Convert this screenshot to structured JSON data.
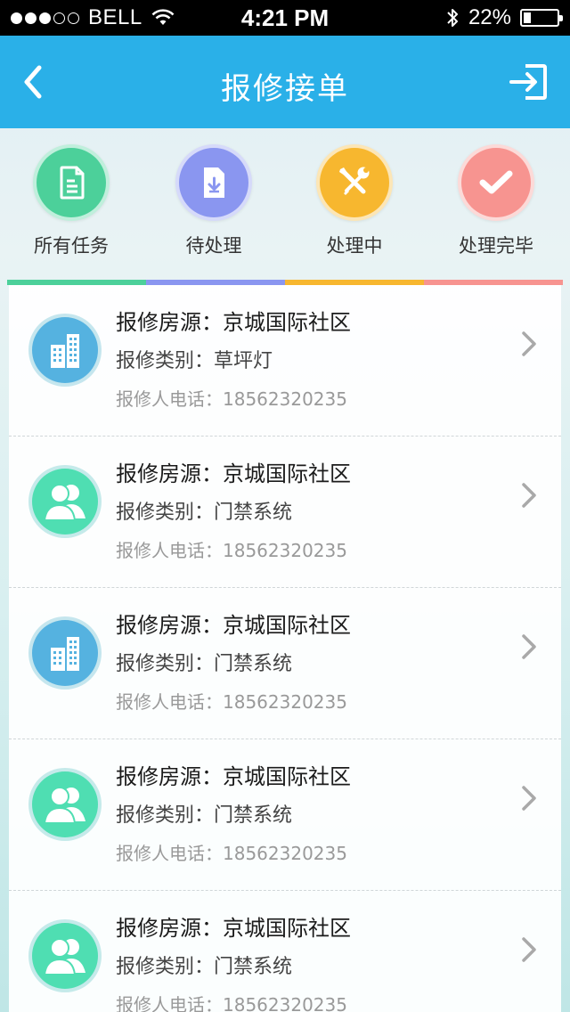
{
  "status_bar": {
    "carrier": "BELL",
    "time": "4:21 PM",
    "battery_percent": "22%",
    "battery_level": 0.22,
    "signal_bars_filled": 3,
    "signal_bars_total": 5
  },
  "nav": {
    "title": "报修接单",
    "back_icon": "chevron-left-icon",
    "logout_icon": "logout-icon"
  },
  "categories": [
    {
      "label": "所有任务",
      "color": "#4cd09a",
      "icon": "document-icon"
    },
    {
      "label": "待处理",
      "color": "#8a96f0",
      "icon": "download-document-icon"
    },
    {
      "label": "处理中",
      "color": "#f7b72f",
      "icon": "tools-icon"
    },
    {
      "label": "处理完毕",
      "color": "#f79490",
      "icon": "checkmark-icon"
    }
  ],
  "tab_colors": [
    "#4cd09a",
    "#8a96f0",
    "#f7b72f",
    "#f79490"
  ],
  "list": {
    "items": [
      {
        "source": "报修房源：京城国际社区",
        "category": "报修类别：草坪灯",
        "phone": "报修人电话：18562320235",
        "avatar": "building-icon",
        "avatar_color": "#55b2e0"
      },
      {
        "source": "报修房源：京城国际社区",
        "category": "报修类别：门禁系统",
        "phone": "报修人电话：18562320235",
        "avatar": "users-icon",
        "avatar_color": "#4fdeb2"
      },
      {
        "source": "报修房源：京城国际社区",
        "category": "报修类别：门禁系统",
        "phone": "报修人电话：18562320235",
        "avatar": "building-icon",
        "avatar_color": "#55b2e0"
      },
      {
        "source": "报修房源：京城国际社区",
        "category": "报修类别：门禁系统",
        "phone": "报修人电话：18562320235",
        "avatar": "users-icon",
        "avatar_color": "#4fdeb2"
      },
      {
        "source": "报修房源：京城国际社区",
        "category": "报修类别：门禁系统",
        "phone": "报修人电话：18562320235",
        "avatar": "users-icon",
        "avatar_color": "#4fdeb2"
      }
    ]
  }
}
